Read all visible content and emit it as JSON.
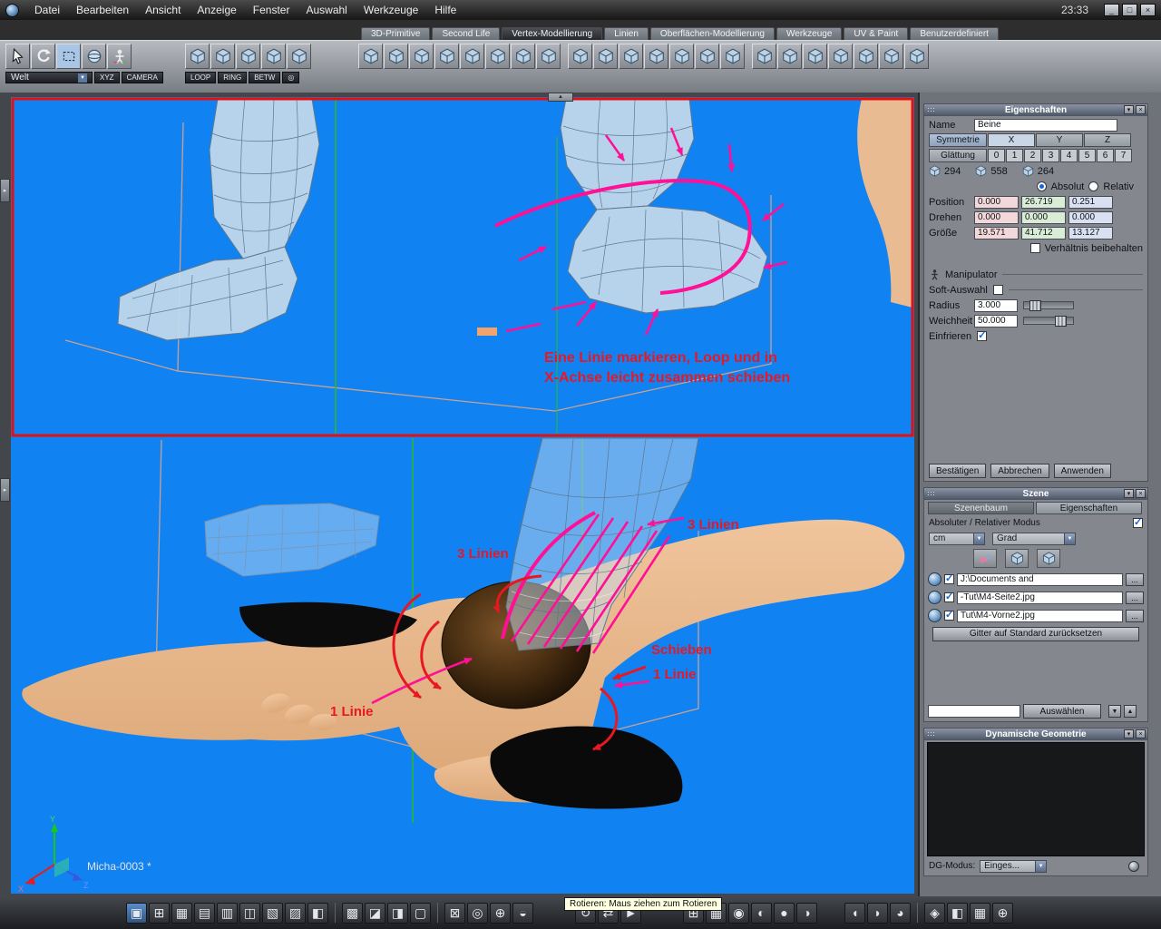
{
  "window": {
    "clock": "23:33",
    "minimize": "_",
    "maximize": "□",
    "close": "×"
  },
  "menubar": {
    "items": [
      "Datei",
      "Bearbeiten",
      "Ansicht",
      "Anzeige",
      "Fenster",
      "Auswahl",
      "Werkzeuge",
      "Hilfe"
    ]
  },
  "ribbon": {
    "tabs": [
      "3D-Primitive",
      "Second Life",
      "Vertex-Modellierung",
      "Linien",
      "Oberflächen-Modellierung",
      "Werkzeuge",
      "UV & Paint",
      "Benutzerdefiniert"
    ],
    "active_tab": "Vertex-Modellierung"
  },
  "left_tools": {
    "world": "Welt",
    "xyz": "XYZ",
    "camera": "CAMERA",
    "loop": "LOOP",
    "ring": "RING",
    "betw": "BETW"
  },
  "icons": {
    "collapse": "▾",
    "close": "×",
    "dropdown": "▼",
    "up": "▲",
    "handle_right": "▸",
    "handle_up": "▲"
  },
  "properties": {
    "title": "Eigenschaften",
    "name_label": "Name",
    "name_value": "Beine",
    "symmetry_label": "Symmetrie",
    "axis_x": "X",
    "axis_y": "Y",
    "axis_z": "Z",
    "smoothing_label": "Glättung",
    "smoothing_levels": [
      "0",
      "1",
      "2",
      "3",
      "4",
      "5",
      "6",
      "7"
    ],
    "vertex_count": "294",
    "edge_count": "558",
    "face_count": "264",
    "absolute_label": "Absolut",
    "relative_label": "Relativ",
    "absolute_selected": true,
    "position_label": "Position",
    "position": [
      "0.000",
      "26.719",
      "0.251"
    ],
    "rotate_label": "Drehen",
    "rotation": [
      "0.000",
      "0.000",
      "0.000"
    ],
    "size_label": "Größe",
    "size": [
      "19.571",
      "41.712",
      "13.127"
    ],
    "keep_ratio_label": "Verhältnis beibehalten",
    "keep_ratio_checked": false,
    "manipulator_label": "Manipulator",
    "soft_selection_label": "Soft-Auswahl",
    "soft_selection_checked": false,
    "radius_label": "Radius",
    "radius_value": "3.000",
    "softness_label": "Weichheit",
    "softness_value": "50.000",
    "freeze_label": "Einfrieren",
    "freeze_checked": true,
    "confirm": "Bestätigen",
    "cancel": "Abbrechen",
    "apply": "Anwenden"
  },
  "scene": {
    "title": "Szene",
    "tab_tree": "Szenenbaum",
    "tab_props": "Eigenschaften",
    "active_tab": "Eigenschaften",
    "mode_label": "Absoluter / Relativer Modus",
    "mode_checked": true,
    "unit": "cm",
    "angle_unit": "Grad",
    "files": [
      "J:\\Documents and",
      "-Tut\\M4-Seite2.jpg",
      "Tut\\M4-Vorne2.jpg"
    ],
    "more_label": "...",
    "reset_grid": "Gitter auf Standard zurücksetzen",
    "select_button": "Auswählen"
  },
  "dynamic_geometry": {
    "title": "Dynamische Geometrie",
    "mode_label": "DG-Modus:",
    "mode_value": "Einges..."
  },
  "viewport": {
    "status": "Micha-0003 *",
    "annotations": {
      "note_line1": "Eine Linie markieren, Loop und in",
      "note_line2": "X-Achse leicht zusammen schieben",
      "three_lines_left": "3 Linien",
      "three_lines_right": "3 Linien",
      "push": "Schieben",
      "one_line_right": "1 Linie",
      "one_line_left": "1 Linie"
    },
    "axis": {
      "x": "X",
      "y": "Y",
      "z": "Z"
    }
  },
  "bottombar": {
    "tooltip": "Rotieren: Maus ziehen zum Rotieren",
    "groups": [
      [
        "▣",
        "⊞",
        "▦",
        "▤",
        "▥",
        "◫",
        "▧",
        "▨",
        "◧"
      ],
      [
        "▩",
        "◪",
        "◨",
        "▢"
      ],
      [
        "⊠",
        "◎",
        "⊕",
        "◒"
      ],
      [
        "↻",
        "⇄",
        "►"
      ],
      [
        "⊞",
        "▦",
        "◉",
        "◐",
        "●",
        "◑"
      ],
      [
        "◖",
        "◗",
        "◕"
      ],
      [
        "◈",
        "◧",
        "▦",
        "⊕"
      ]
    ]
  },
  "colors": {
    "viewport_blue": "#1182f2",
    "annotation_pink": "#ff1096",
    "annotation_red": "#e81822",
    "selection_blue": "#9fc2e8",
    "highlight_box": "#e41010"
  }
}
